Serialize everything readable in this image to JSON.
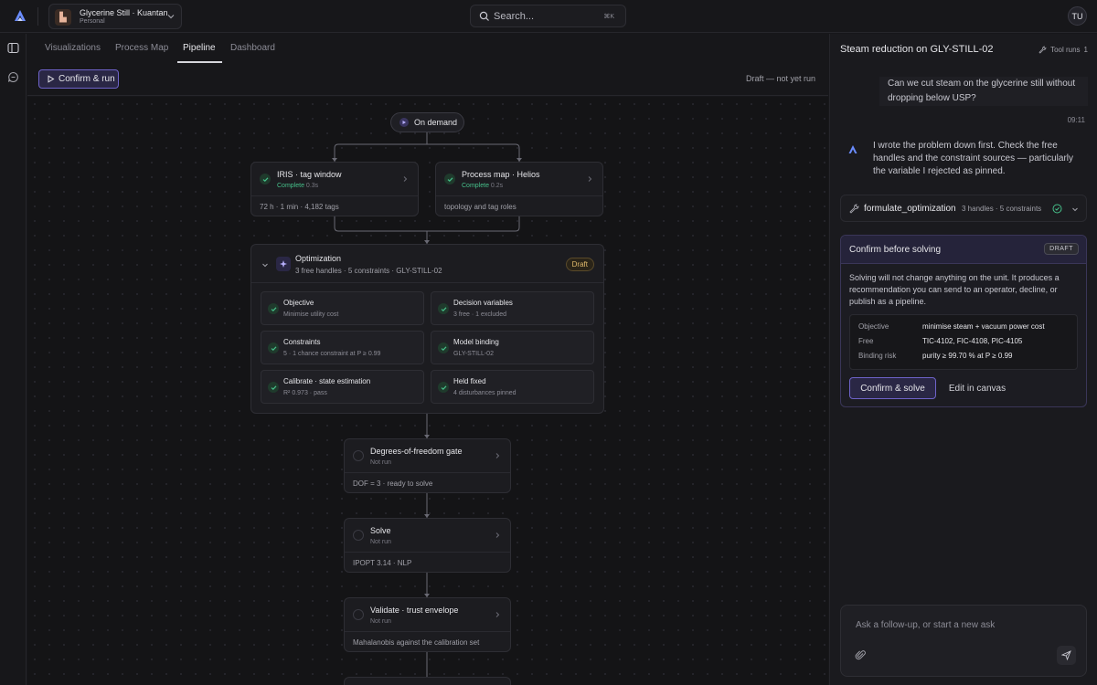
{
  "app": {
    "project_name": "Glycerine Still · Kuantan",
    "project_sub": "Personal",
    "search_placeholder": "Search...",
    "search_shortcut": "⌘K",
    "user_initials": "TU"
  },
  "tabs": [
    "Visualizations",
    "Process Map",
    "Pipeline",
    "Dashboard"
  ],
  "active_tab": "Pipeline",
  "toolbar": {
    "confirm_run": "Confirm & run",
    "status": "Draft — not yet run"
  },
  "pipeline": {
    "trigger": "On demand",
    "iris": {
      "title": "IRIS · tag window",
      "status": "Complete",
      "time": "0.3s",
      "detail": "72 h · 1 min · 4,182 tags"
    },
    "pmap": {
      "title": "Process map · Helios",
      "status": "Complete",
      "time": "0.2s",
      "detail": "topology and tag roles"
    },
    "optimization": {
      "title": "Optimization",
      "sub": "3 free handles · 5 constraints · GLY-STILL-02",
      "badge": "Draft",
      "cells": [
        {
          "title": "Objective",
          "sub": "Minimise utility cost"
        },
        {
          "title": "Decision variables",
          "sub": "3 free · 1 excluded"
        },
        {
          "title": "Constraints",
          "sub": "5 · 1 chance constraint at P ≥ 0.99"
        },
        {
          "title": "Model binding",
          "sub": "GLY-STILL-02"
        },
        {
          "title": "Calibrate · state estimation",
          "sub": "R² 0.973 · pass"
        },
        {
          "title": "Held fixed",
          "sub": "4 disturbances pinned"
        }
      ]
    },
    "dof": {
      "title": "Degrees-of-freedom gate",
      "status": "Not run",
      "detail": "DOF = 3 · ready to solve"
    },
    "solve": {
      "title": "Solve",
      "status": "Not run",
      "detail": "IPOPT 3.14 · NLP"
    },
    "validate": {
      "title": "Validate · trust envelope",
      "status": "Not run",
      "detail": "Mahalanobis against the calibration set"
    }
  },
  "chat": {
    "title": "Steam reduction on GLY-STILL-02",
    "tool_runs_label": "Tool runs",
    "tool_runs_count": "1",
    "user_message": "Can we cut steam on the glycerine still without dropping below USP?",
    "user_time": "09:11",
    "assistant_message": "I wrote the problem down first. Check the free handles and the constraint sources — particularly the variable I rejected as pinned.",
    "tool_call": {
      "name": "formulate_optimization",
      "meta": "3 handles · 5 constraints"
    },
    "confirm_card": {
      "title": "Confirm before solving",
      "badge": "DRAFT",
      "body": "Solving will not change anything on the unit. It produces a recommendation you can send to an operator, decline, or publish as a pipeline.",
      "rows": [
        {
          "key": "Objective",
          "value": "minimise steam + vacuum power cost"
        },
        {
          "key": "Free",
          "value": "TIC-4102, FIC-4108, PIC-4105"
        },
        {
          "key": "Binding risk",
          "value": "purity ≥ 99.70 % at P ≥ 0.99"
        }
      ],
      "primary": "Confirm & solve",
      "secondary": "Edit in canvas"
    },
    "composer_placeholder": "Ask a follow-up, or start a new ask"
  },
  "colors": {
    "accent": "#6e63c9",
    "success": "#46c08a",
    "draft": "#e0b96b"
  }
}
